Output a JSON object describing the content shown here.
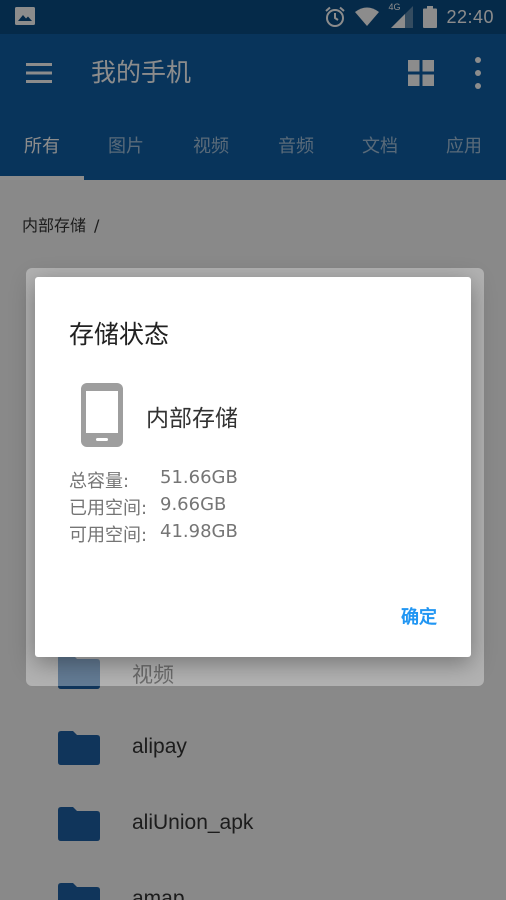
{
  "status_bar": {
    "time": "22:40",
    "network": "4G"
  },
  "toolbar": {
    "title": "我的手机"
  },
  "tabs": [
    {
      "label": "所有",
      "active": true
    },
    {
      "label": "图片",
      "active": false
    },
    {
      "label": "视频",
      "active": false
    },
    {
      "label": "音频",
      "active": false
    },
    {
      "label": "文档",
      "active": false
    },
    {
      "label": "应用",
      "active": false
    }
  ],
  "breadcrumb": {
    "path": "内部存储",
    "separator": "/"
  },
  "files": [
    {
      "name": "视频"
    },
    {
      "name": "alipay"
    },
    {
      "name": "aliUnion_apk"
    },
    {
      "name": "amap"
    }
  ],
  "dialog": {
    "title": "存储状态",
    "storage_name": "内部存储",
    "stats": [
      {
        "label": "总容量:",
        "value": "51.66GB"
      },
      {
        "label": "已用空间:",
        "value": "9.66GB"
      },
      {
        "label": "可用空间:",
        "value": "41.98GB"
      }
    ],
    "ok_label": "确定"
  },
  "colors": {
    "primary": "#0f5fa6",
    "status_bar": "#0a4d86",
    "accent": "#2196f3",
    "folder": "#1e62a6"
  }
}
